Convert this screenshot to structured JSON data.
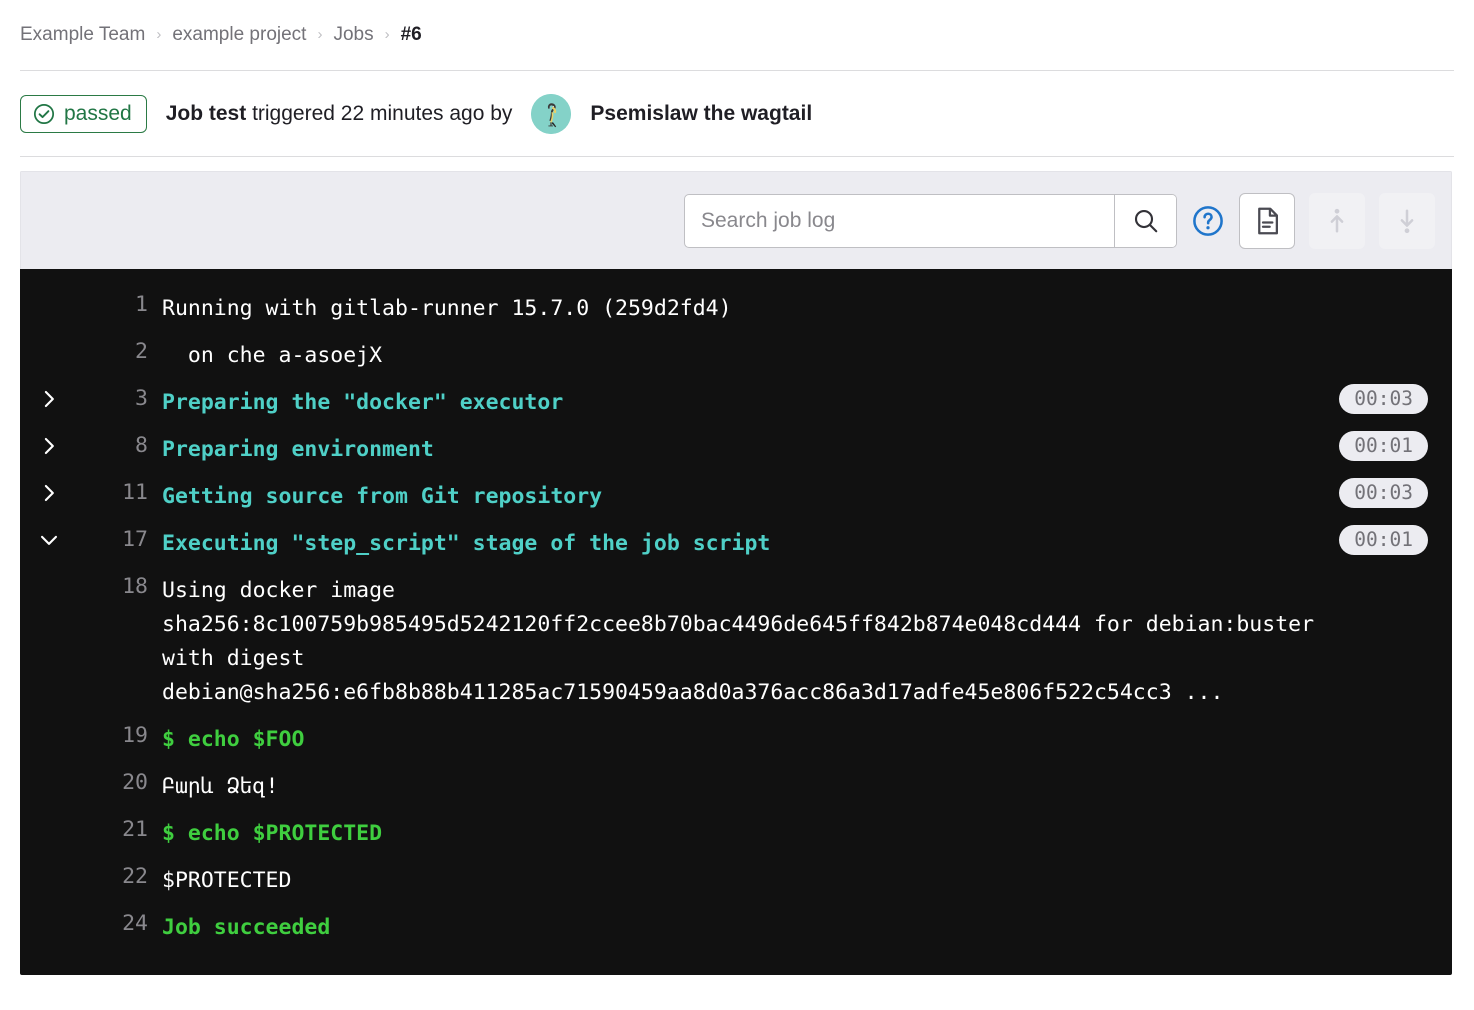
{
  "breadcrumb": {
    "items": [
      {
        "label": "Example Team",
        "current": false
      },
      {
        "label": "example project",
        "current": false
      },
      {
        "label": "Jobs",
        "current": false
      },
      {
        "label": "#6",
        "current": true
      }
    ],
    "separator": "›"
  },
  "job_header": {
    "status": {
      "label": "passed",
      "icon": "check-circle-icon",
      "color": "#217645"
    },
    "title_strong": "Job test",
    "title_rest": " triggered 22 minutes ago by",
    "user": {
      "name": "Psemislaw the wagtail",
      "avatar_icon": "wagtail-bird-avatar"
    }
  },
  "toolbar": {
    "search": {
      "value": "",
      "placeholder": "Search job log",
      "icon": "search-icon"
    },
    "help_icon": "help-circle-icon",
    "raw_log_icon": "document-icon",
    "scroll_top_icon": "scroll-to-top-icon",
    "scroll_bottom_icon": "scroll-to-bottom-icon",
    "scroll_top_disabled": true,
    "scroll_bottom_disabled": true
  },
  "log": {
    "background": "#111111",
    "lines": [
      {
        "number": "1",
        "text": "Running with gitlab-runner 15.7.0 (259d2fd4)",
        "style": "plain",
        "toggle": "none",
        "duration": ""
      },
      {
        "number": "2",
        "text": "  on che a-asoejX",
        "style": "plain",
        "toggle": "none",
        "duration": ""
      },
      {
        "number": "3",
        "text": "Preparing the \"docker\" executor",
        "style": "section",
        "toggle": "collapsed",
        "duration": "00:03"
      },
      {
        "number": "8",
        "text": "Preparing environment",
        "style": "section",
        "toggle": "collapsed",
        "duration": "00:01"
      },
      {
        "number": "11",
        "text": "Getting source from Git repository",
        "style": "section",
        "toggle": "collapsed",
        "duration": "00:03"
      },
      {
        "number": "17",
        "text": "Executing \"step_script\" stage of the job script",
        "style": "section",
        "toggle": "expanded",
        "duration": "00:01"
      },
      {
        "number": "18",
        "text": "Using docker image sha256:8c100759b985495d5242120ff2ccee8b70bac4496de645ff842b874e048cd444 for debian:buster with digest debian@sha256:e6fb8b88b411285ac71590459aa8d0a376acc86a3d17adfe45e806f522c54cc3 ...",
        "style": "plain",
        "toggle": "none",
        "duration": ""
      },
      {
        "number": "19",
        "text": "$ echo $FOO",
        "style": "green",
        "toggle": "none",
        "duration": ""
      },
      {
        "number": "20",
        "text": "Բարև Ձեզ!",
        "style": "plain",
        "toggle": "none",
        "duration": ""
      },
      {
        "number": "21",
        "text": "$ echo $PROTECTED",
        "style": "green",
        "toggle": "none",
        "duration": ""
      },
      {
        "number": "22",
        "text": "$PROTECTED",
        "style": "plain",
        "toggle": "none",
        "duration": ""
      },
      {
        "number": "24",
        "text": "Job succeeded",
        "style": "green",
        "toggle": "none",
        "duration": ""
      }
    ]
  },
  "colors": {
    "section_teal": "#4fd0c7",
    "success_green": "#3fce3f",
    "status_green": "#217645",
    "toolbar_bg": "#ececf1",
    "help_blue": "#1f75cb"
  }
}
